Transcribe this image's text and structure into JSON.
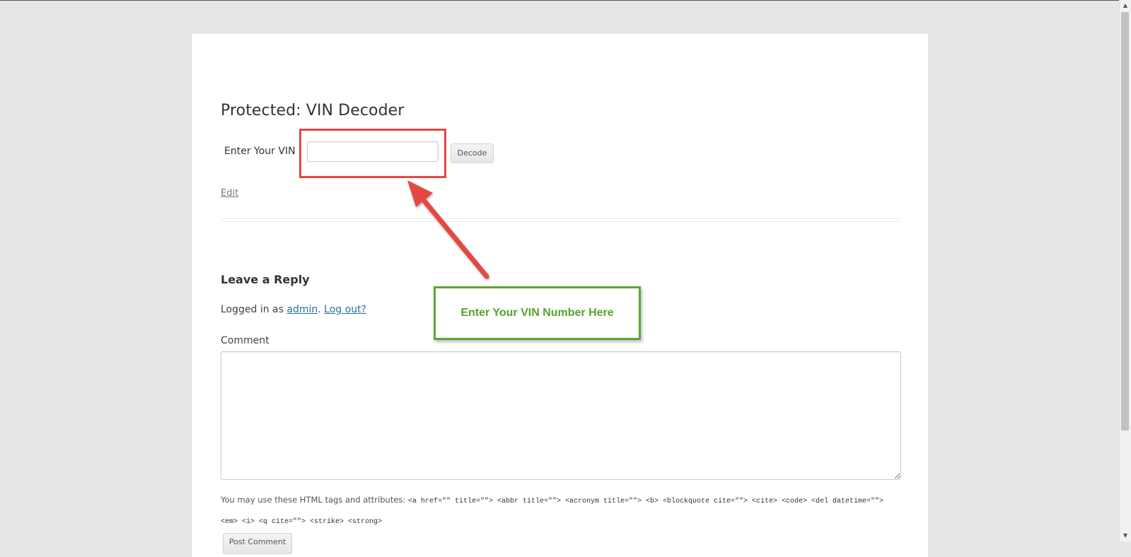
{
  "post": {
    "title": "Protected: VIN Decoder",
    "vin_label": "Enter Your VIN",
    "vin_value": "",
    "decode_label": "Decode",
    "edit_label": "Edit"
  },
  "reply": {
    "title": "Leave a Reply",
    "logged_in_prefix": "Logged in as ",
    "user": "admin",
    "separator": ". ",
    "logout_label": "Log out?",
    "comment_label": "Comment",
    "comment_value": "",
    "allowed_prefix": "You may use these HTML tags and attributes: ",
    "allowed_tags": "<a href=\"\" title=\"\"> <abbr title=\"\"> <acronym title=\"\"> <b> <blockquote cite=\"\"> <cite> <code> <del datetime=\"\"> <em> <i> <q cite=\"\"> <strike> <strong>",
    "post_button_label": "Post Comment"
  },
  "annotation": {
    "callout_text": "Enter Your VIN Number Here",
    "highlight_color": "#e34a42",
    "callout_color": "#56a22c"
  },
  "scrollbar": {
    "up_icon": "arrow-up",
    "down_icon": "arrow-down"
  }
}
